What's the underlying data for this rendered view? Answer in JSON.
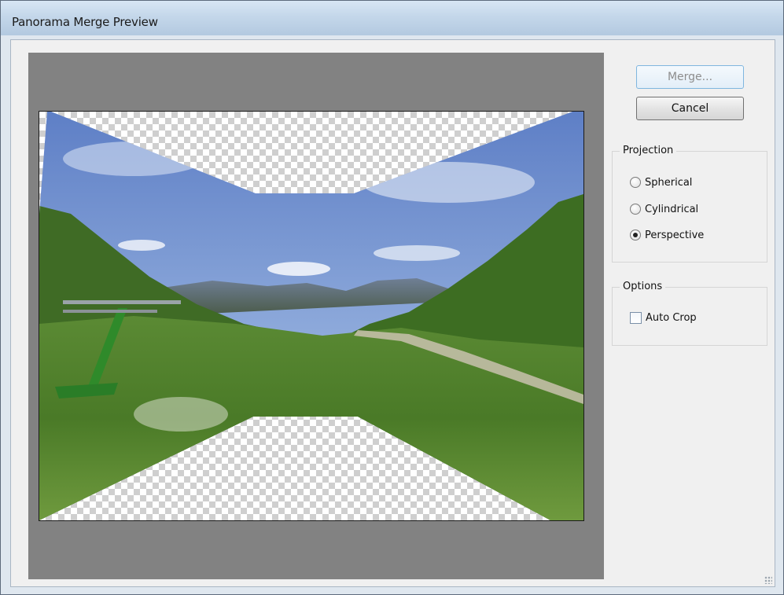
{
  "window": {
    "title": "Panorama Merge Preview"
  },
  "buttons": {
    "merge_label": "Merge...",
    "cancel_label": "Cancel"
  },
  "projection": {
    "legend": "Projection",
    "options": [
      {
        "label": "Spherical",
        "checked": false
      },
      {
        "label": "Cylindrical",
        "checked": false
      },
      {
        "label": "Perspective",
        "checked": true
      }
    ]
  },
  "options_group": {
    "legend": "Options",
    "auto_crop": {
      "label": "Auto Crop",
      "checked": false
    }
  },
  "colors": {
    "preview_background": "#828282",
    "sky": "#6f8fd0",
    "grass": "#4f7f2e",
    "title_bar": "#c4d7ea"
  }
}
